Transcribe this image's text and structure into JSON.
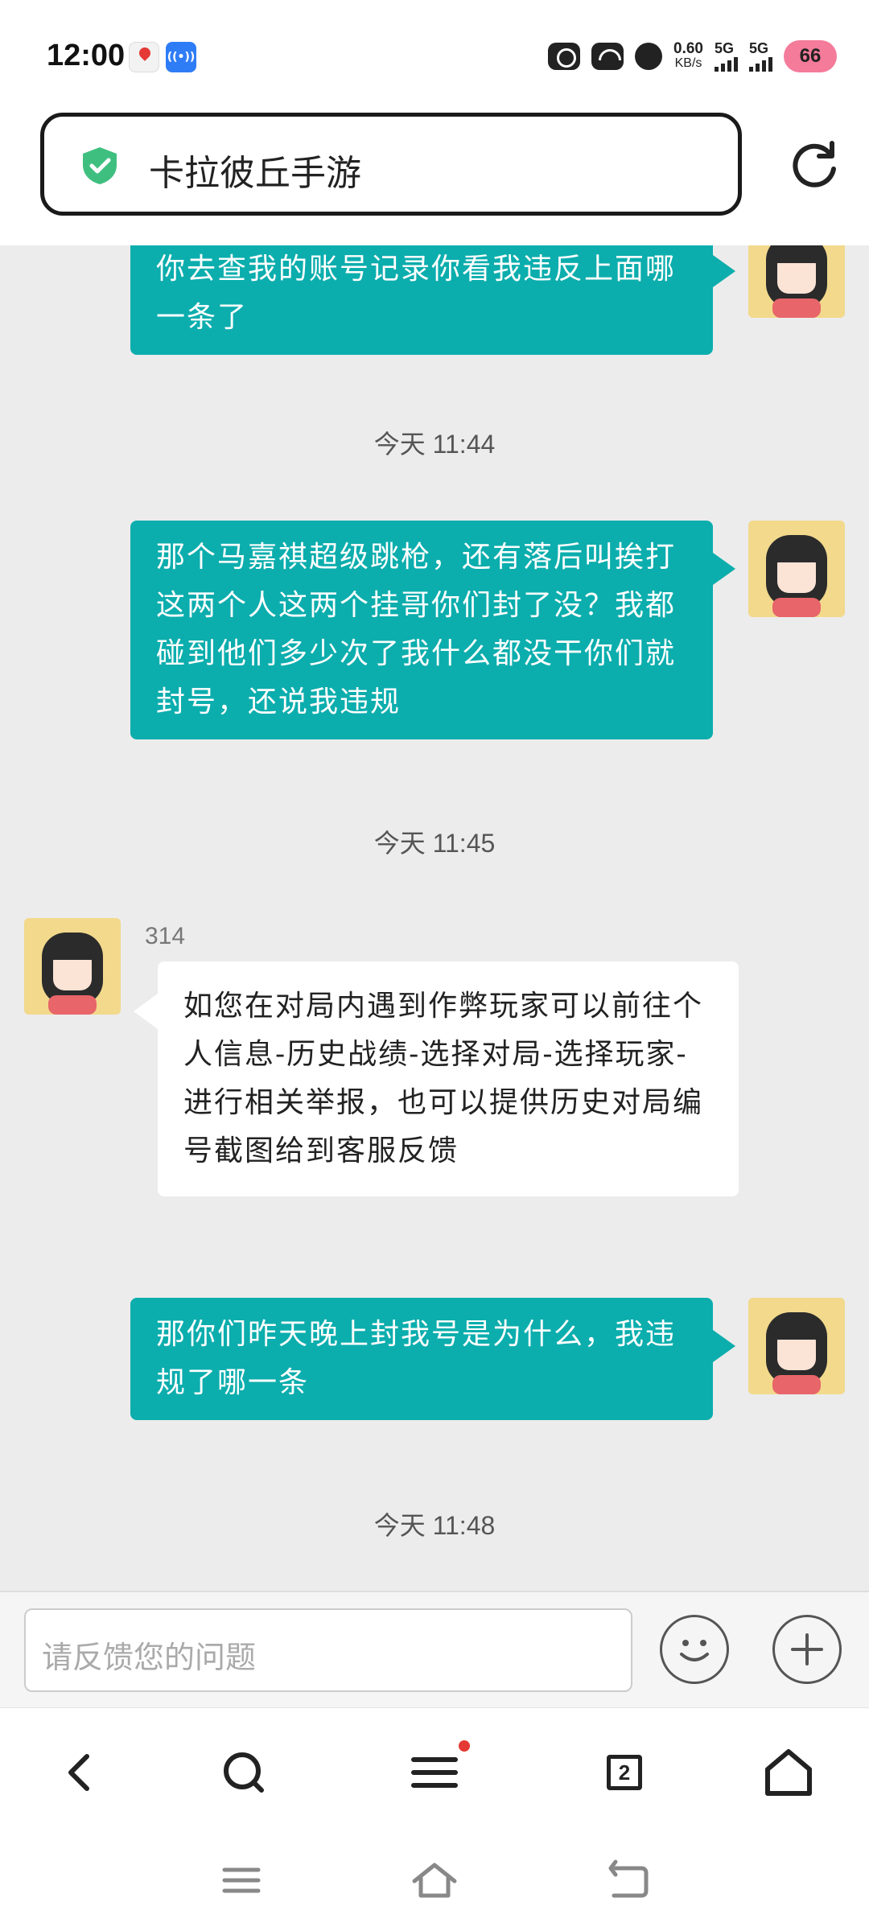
{
  "status_bar": {
    "time": "12:00",
    "net_speed_value": "0.60",
    "net_speed_unit": "KB/s",
    "sim1": "5G",
    "sim2": "5G",
    "battery": "66"
  },
  "address_bar": {
    "title": "卡拉彼丘手游"
  },
  "chat": {
    "messages": [
      {
        "text": "你去查我的账号记录你看我违反上面哪一条了"
      },
      {
        "timestamp": "今天 11:44"
      },
      {
        "text": "那个马嘉祺超级跳枪，还有落后叫挨打这两个人这两个挂哥你们封了没？我都碰到他们多少次了我什么都没干你们就封号，还说我违规"
      },
      {
        "timestamp": "今天 11:45"
      },
      {
        "sender": "314",
        "text": "如您在对局内遇到作弊玩家可以前往个人信息-历史战绩-选择对局-选择玩家-进行相关举报，也可以提供历史对局编号截图给到客服反馈"
      },
      {
        "text": "那你们昨天晚上封我号是为什么，我违规了哪一条"
      },
      {
        "timestamp": "今天 11:48"
      }
    ]
  },
  "input": {
    "placeholder": "请反馈您的问题"
  },
  "browser_nav": {
    "tab_count": "2"
  },
  "colors": {
    "outgoing_bubble": "#0cadad",
    "chat_background": "#ececec",
    "shield": "#3fbf7f"
  }
}
